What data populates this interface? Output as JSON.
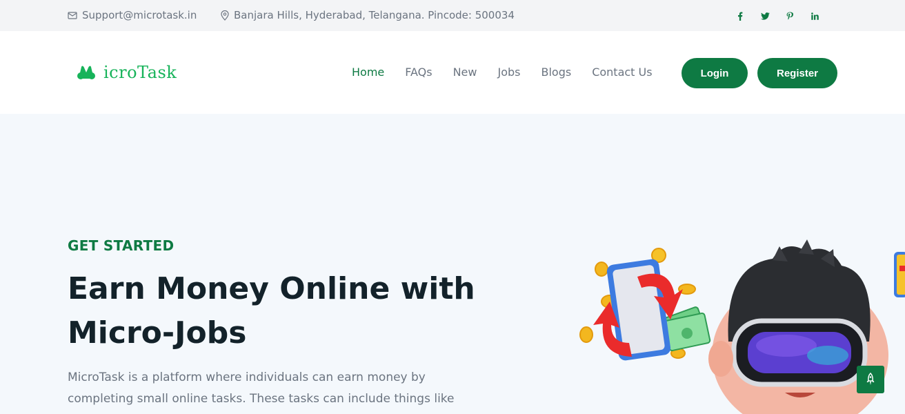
{
  "topbar": {
    "email": "Support@microtask.in",
    "address": "Banjara Hills, Hyderabad, Telangana. Pincode: 500034",
    "socials": [
      "facebook-icon",
      "twitter-icon",
      "pinterest-icon",
      "linkedin-icon"
    ]
  },
  "header": {
    "logo_text": "icroTask",
    "nav": {
      "home": "Home",
      "faqs": "FAQs",
      "new": "New",
      "jobs": "Jobs",
      "blogs": "Blogs",
      "contact": "Contact Us"
    },
    "login_label": "Login",
    "register_label": "Register"
  },
  "hero": {
    "eyebrow": "GET STARTED",
    "title": "Earn Money Online with Micro-Jobs",
    "description": "MicroTask is a platform where individuals can earn money by completing small online tasks. These tasks can include things like"
  },
  "colors": {
    "brand": "#0e7a43",
    "logo": "#17b35a",
    "text_dark": "#13222a",
    "text_muted": "#6b7480",
    "hero_bg": "#f4f8fc"
  }
}
